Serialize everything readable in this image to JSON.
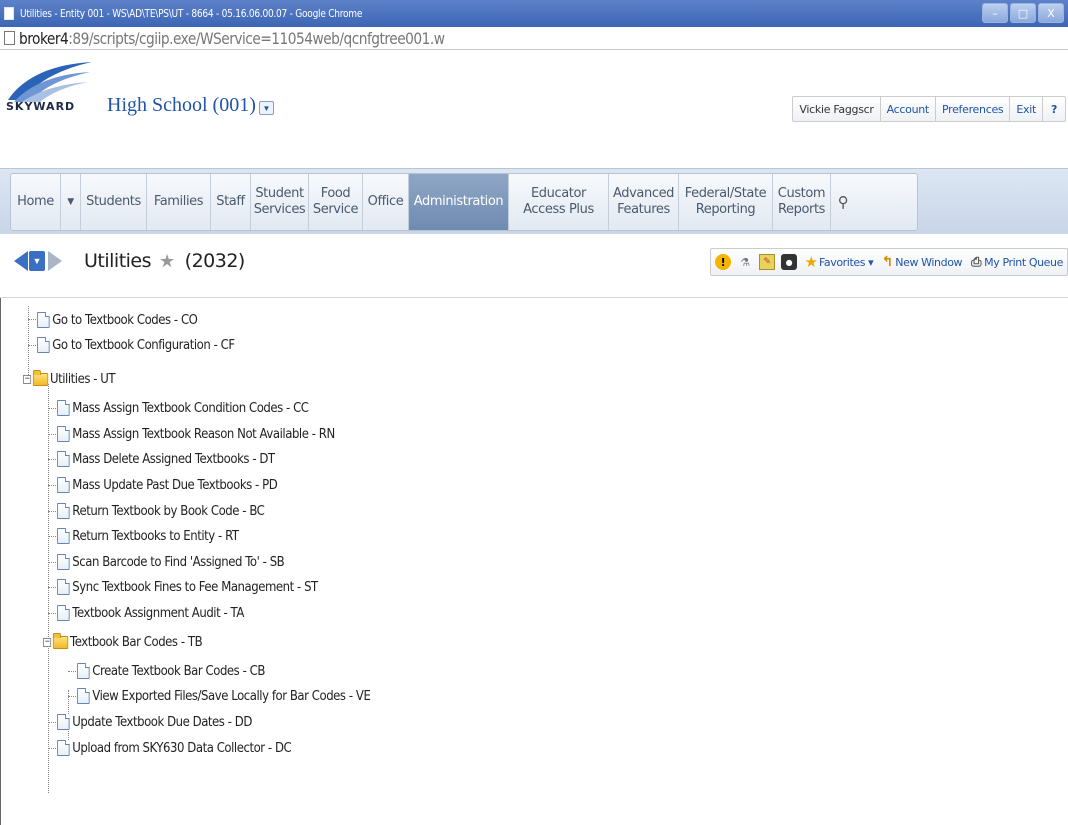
{
  "window": {
    "title": "Utilities - Entity 001 - WS\\AD\\TE\\PS\\UT - 8664 - 05.16.06.00.07 - Google Chrome",
    "controls": [
      "–",
      "□",
      "X"
    ]
  },
  "address": {
    "host": "broker4",
    "path": ":89/scripts/cgiip.exe/WService=11054web/qcnfgtree001.w"
  },
  "header": {
    "logo_text": "SKYWARD",
    "entity": "High School (001)",
    "user": "Vickie Faggscr",
    "account": "Account",
    "preferences": "Preferences",
    "exit": "Exit",
    "help": "?"
  },
  "nav": {
    "home": "Home",
    "students": "Students",
    "families": "Families",
    "staff": "Staff",
    "student_services_1": "Student",
    "student_services_2": "Services",
    "food_service_1": "Food",
    "food_service_2": "Service",
    "office": "Office",
    "administration": "Administration",
    "educator_1": "Educator",
    "educator_2": "Access Plus",
    "advanced_1": "Advanced",
    "advanced_2": "Features",
    "federal_1": "Federal/State",
    "federal_2": "Reporting",
    "custom_1": "Custom",
    "custom_2": "Reports"
  },
  "toolbar": {
    "page_title": "Utilities",
    "count": "(2032)",
    "favorites": "Favorites ▾",
    "new_window": "New Window",
    "print_queue": "My Print Queue"
  },
  "tree": {
    "items": [
      {
        "label": "Go to Textbook Codes - CO"
      },
      {
        "label": "Go to Textbook Configuration - CF"
      },
      {
        "label": "Utilities - UT"
      },
      {
        "label": "Mass Assign Textbook Condition Codes - CC"
      },
      {
        "label": "Mass Assign Textbook Reason Not Available - RN"
      },
      {
        "label": "Mass Delete Assigned Textbooks - DT"
      },
      {
        "label": "Mass Update Past Due Textbooks - PD"
      },
      {
        "label": "Return Textbook by Book Code - BC"
      },
      {
        "label": "Return Textbooks to Entity - RT"
      },
      {
        "label": "Scan Barcode to Find 'Assigned To' - SB"
      },
      {
        "label": "Sync Textbook Fines to Fee Management - ST"
      },
      {
        "label": "Textbook Assignment Audit - TA"
      },
      {
        "label": "Textbook Bar Codes - TB"
      },
      {
        "label": "Create Textbook Bar Codes - CB"
      },
      {
        "label": "View Exported Files/Save Locally for Bar Codes - VE"
      },
      {
        "label": "Update Textbook Due Dates - DD"
      },
      {
        "label": "Upload from SKY630 Data Collector - DC"
      }
    ]
  }
}
